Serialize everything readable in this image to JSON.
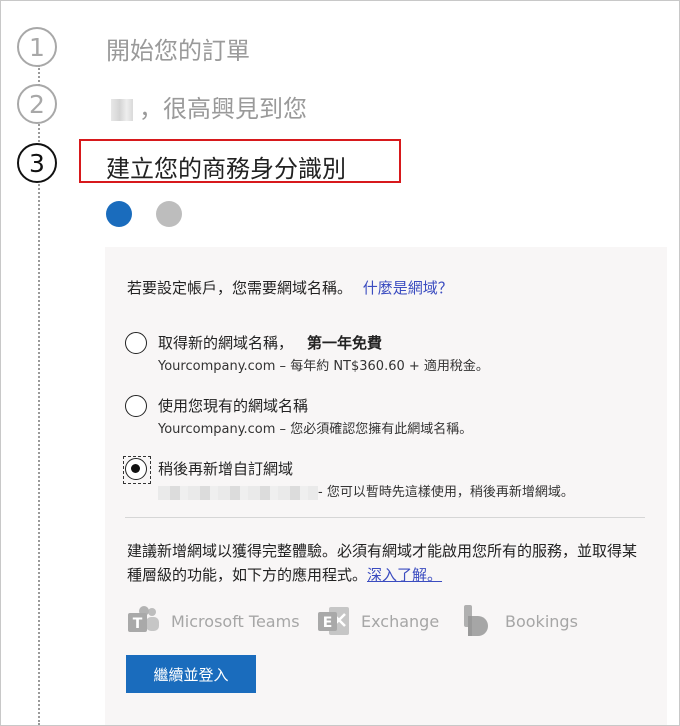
{
  "steps": [
    {
      "number": "1",
      "title": "開始您的訂單",
      "state": "done"
    },
    {
      "number": "2",
      "title": "，很高興見到您",
      "state": "done"
    },
    {
      "number": "3",
      "title": "建立您的商務身分識別",
      "state": "active"
    }
  ],
  "progress_dots": {
    "current": 1,
    "total": 2,
    "active_color": "#1a6cbd",
    "inactive_color": "#bdbdbd"
  },
  "panel": {
    "intro_text": "若要設定帳戶，您需要網域名稱。",
    "intro_link": "什麼是網域？",
    "options": [
      {
        "label": "取得新的網域名稱，",
        "badge": "第一年免費",
        "sub": "Yourcompany.com – 每年約 NT$360.60 + 適用稅金。",
        "checked": false
      },
      {
        "label": "使用您現有的網域名稱",
        "sub": "Yourcompany.com – 您必須確認您擁有此網域名稱。",
        "checked": false
      },
      {
        "label": "稍後再新增自訂網域",
        "sub": "- 您可以暫時先這樣使用，稍後再新增網域。",
        "checked": true
      }
    ],
    "recommend_text": "建議新增網域以獲得完整體驗。必須有網域才能啟用您所有的服務，並取得某種層級的功能，如下方的應用程式。",
    "recommend_link": "深入了解。",
    "apps": [
      {
        "name": "Microsoft Teams",
        "icon": "teams-icon"
      },
      {
        "name": "Exchange",
        "icon": "exchange-icon"
      },
      {
        "name": "Bookings",
        "icon": "bookings-icon"
      }
    ],
    "continue_button": "繼續並登入"
  },
  "colors": {
    "accent": "#1a6cbd",
    "highlight_box": "#d7191c"
  }
}
